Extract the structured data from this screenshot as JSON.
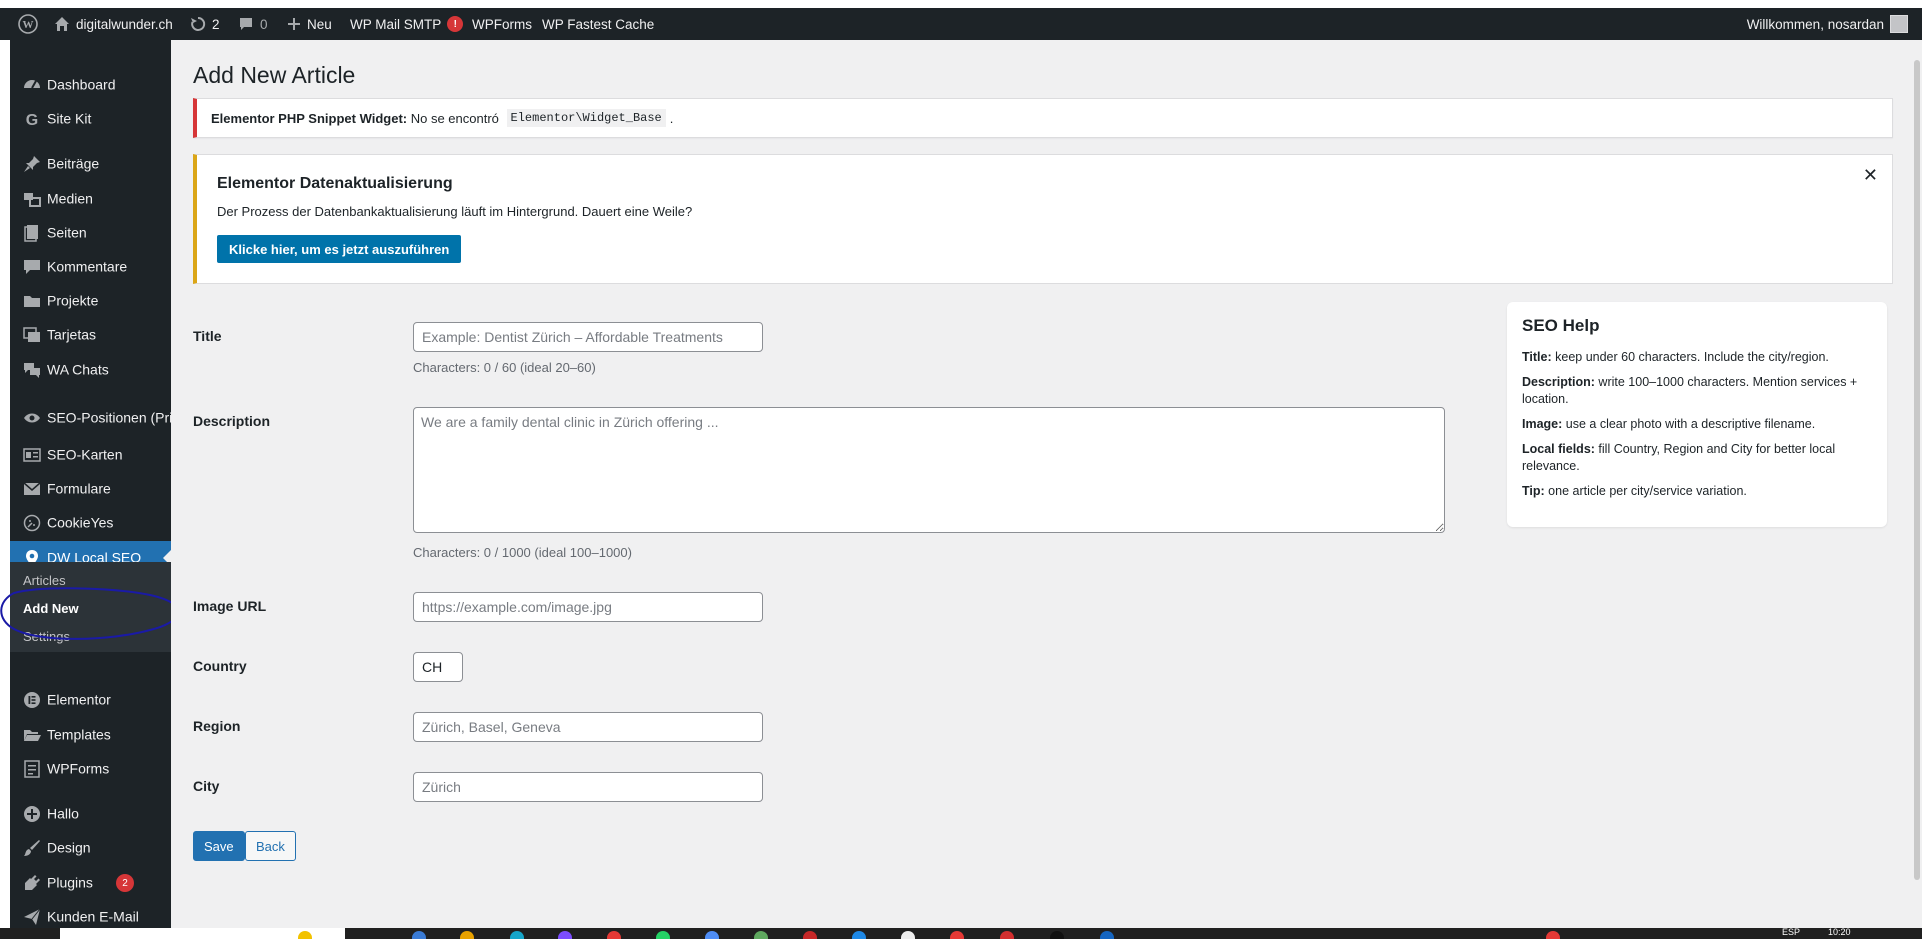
{
  "admin_bar": {
    "site_name": "digitalwunder.ch",
    "updates_count": "2",
    "comments_count": "0",
    "new_label": "Neu",
    "wp_mail_smtp": "WP Mail SMTP",
    "wp_mail_smtp_badge": "!",
    "wpforms": "WPForms",
    "wp_fastest_cache": "WP Fastest Cache",
    "greeting": "Willkommen, nosardan"
  },
  "sidebar": {
    "items": [
      {
        "label": "Dashboard",
        "icon": "dashboard-icon"
      },
      {
        "label": "Site Kit",
        "icon": "google-g-icon"
      },
      {
        "label": "Beiträge",
        "icon": "pin-icon"
      },
      {
        "label": "Medien",
        "icon": "media-icon"
      },
      {
        "label": "Seiten",
        "icon": "page-icon"
      },
      {
        "label": "Kommentare",
        "icon": "comment-icon"
      },
      {
        "label": "Projekte",
        "icon": "folder-icon"
      },
      {
        "label": "Tarjetas",
        "icon": "cards-icon"
      },
      {
        "label": "WA Chats",
        "icon": "chats-icon"
      },
      {
        "label": "SEO-Positionen (Privat)",
        "icon": "eye-icon"
      },
      {
        "label": "SEO-Karten",
        "icon": "id-card-icon"
      },
      {
        "label": "Formulare",
        "icon": "mail-icon"
      },
      {
        "label": "CookieYes",
        "icon": "cookie-icon"
      },
      {
        "label": "DW Local SEO",
        "icon": "location-pin-icon"
      },
      {
        "label": "Elementor",
        "icon": "elementor-icon"
      },
      {
        "label": "Templates",
        "icon": "folder-open-icon"
      },
      {
        "label": "WPForms",
        "icon": "form-icon"
      },
      {
        "label": "Hallo",
        "icon": "plus-circle-icon"
      },
      {
        "label": "Design",
        "icon": "brush-icon"
      },
      {
        "label": "Plugins",
        "icon": "plug-icon",
        "badge": "2"
      },
      {
        "label": "Kunden E-Mail",
        "icon": "send-icon"
      }
    ],
    "submenu": [
      "Articles",
      "Add New",
      "Settings"
    ]
  },
  "page": {
    "title": "Add New Article"
  },
  "notice_error": {
    "strong": "Elementor PHP Snippet Widget:",
    "text": "No se encontró",
    "code": "Elementor\\Widget_Base",
    "end": "."
  },
  "notice_warning": {
    "title": "Elementor Datenaktualisierung",
    "text": "Der Prozess der Datenbankaktualisierung läuft im Hintergrund. Dauert eine Weile?",
    "button": "Klicke hier, um es jetzt auszuführen",
    "close": "✕"
  },
  "form": {
    "title_label": "Title",
    "title_placeholder": "Example: Dentist Zürich – Affordable Treatments",
    "title_help": "Characters: 0 / 60 (ideal 20–60)",
    "description_label": "Description",
    "description_placeholder": "We are a family dental clinic in Zürich offering ...",
    "description_help": "Characters: 0 / 1000 (ideal 100–1000)",
    "image_label": "Image URL",
    "image_placeholder": "https://example.com/image.jpg",
    "country_label": "Country",
    "country_value": "CH",
    "region_label": "Region",
    "region_placeholder": "Zürich, Basel, Geneva",
    "city_label": "City",
    "city_placeholder": "Zürich",
    "save_label": "Save",
    "back_label": "Back"
  },
  "seo_help": {
    "title": "SEO Help",
    "lines": [
      {
        "key": "Title:",
        "text": "keep under 60 characters. Include the city/region."
      },
      {
        "key": "Description:",
        "text": "write 100–1000 characters. Mention services + location."
      },
      {
        "key": "Image:",
        "text": "use a clear photo with a descriptive filename."
      },
      {
        "key": "Local fields:",
        "text": "fill Country, Region and City for better local relevance."
      },
      {
        "key": "Tip:",
        "text": "one article per city/service variation."
      }
    ]
  },
  "taskbar": {
    "lang": "ESP",
    "time": "10:20"
  },
  "colors": {
    "admin_bg": "#1d2327",
    "accent": "#2271b1",
    "error": "#d63638",
    "warning": "#dba617",
    "annotation": "#1a1aa6"
  }
}
